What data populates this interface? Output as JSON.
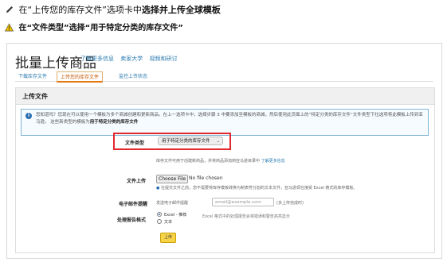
{
  "instruction1": {
    "pre": "在“上传您的库存文件”选项卡中",
    "bold": "选择并上传全球模板"
  },
  "instruction2": "在“文件类型”选择“用于特定分类的库存文件”",
  "page": {
    "title": "批量上传商品",
    "links": [
      "了解更多信息",
      "卖家大学",
      "视频和研讨"
    ],
    "tabs": [
      "下载库存文件",
      "上传您的库存文件",
      "监控上传状态"
    ],
    "active_tab": 1
  },
  "card": {
    "header": "上传文件",
    "info_text": "您知道吗？您现在可以使用一个模板为多个商城创建和更新商品。在上一选项卡中，选择步骤 3 中要添加至模板的商城，然后使用此页面上的“特定分类的库存文件”文件类型下拉选项将此模板上传到亚马逊。 这些新类型的模板为",
    "info_bold": "用于特定分类的库存文件"
  },
  "form": {
    "file_type_label": "文件类型",
    "file_type_value": "用于特定分类的库存文件",
    "file_type_hint": "库存文件可用于创建新商品，并将商品添加到亚马逊目录中",
    "file_type_link": "了解更多信息",
    "file_upload_label": "文件上传",
    "choose_file": "Choose File",
    "no_file": "No file chosen",
    "file_upload_hint": "在提交文件之前，您不需要将库存模板转换为制表符分割的文本文件，亚马逊现在接受 Excel 格式的库存模板。",
    "email_label": "电子邮件提醒",
    "email_prefix": "发送电子邮件提醒",
    "email_placeholder": "email@example.com",
    "email_suffix": "(多上传完成时)",
    "report_label": "处理报告格式",
    "report_options": [
      "Excel - 推荐",
      "文本"
    ],
    "report_hint": "Excel 格式中的处理报告会将错误和警告高亮显示",
    "upload_button": "上传"
  },
  "colors": {
    "highlight": "#e0282e",
    "link": "#2a7ab0",
    "button": "#f7d34a"
  }
}
